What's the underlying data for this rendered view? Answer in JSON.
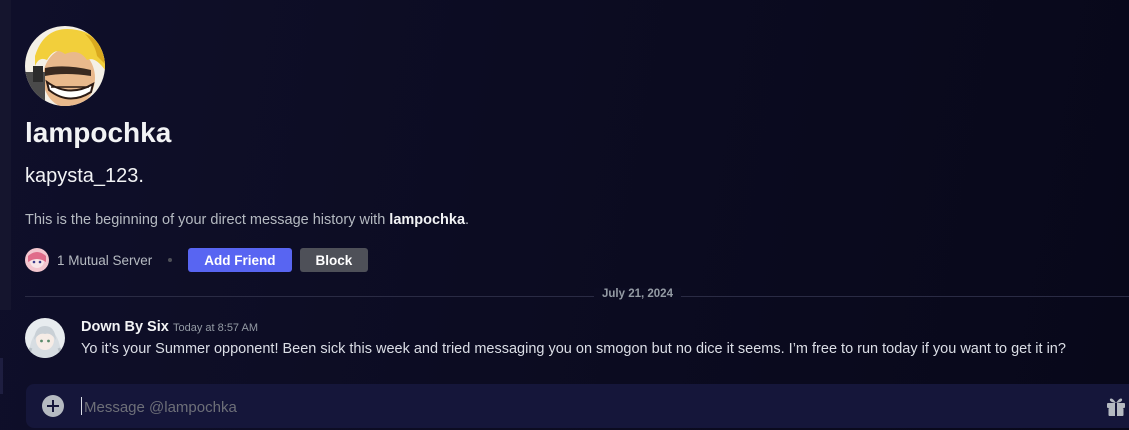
{
  "profile": {
    "display_name": "lampochka",
    "username": "kapysta_123.",
    "intro_prefix": "This is the beginning of your direct message history with ",
    "intro_name": "lampochka",
    "intro_suffix": "."
  },
  "actions": {
    "mutual_servers": "1 Mutual Server",
    "add_friend": "Add Friend",
    "block": "Block"
  },
  "divider": {
    "date": "July 21, 2024"
  },
  "message": {
    "author": "Down By Six",
    "timestamp": "Today at 8:57 AM",
    "text": "Yo it’s your Summer opponent! Been sick this week and tried messaging you on smogon but no dice it seems. I’m free to run today if you want to get  it in?"
  },
  "composer": {
    "placeholder": "Message @lampochka"
  },
  "icons": {
    "add_attachment": "plus-circle-icon",
    "gift": "gift-icon"
  },
  "colors": {
    "accent": "#5865f2",
    "block_button": "#4e5058",
    "background": "#0c0c22"
  }
}
